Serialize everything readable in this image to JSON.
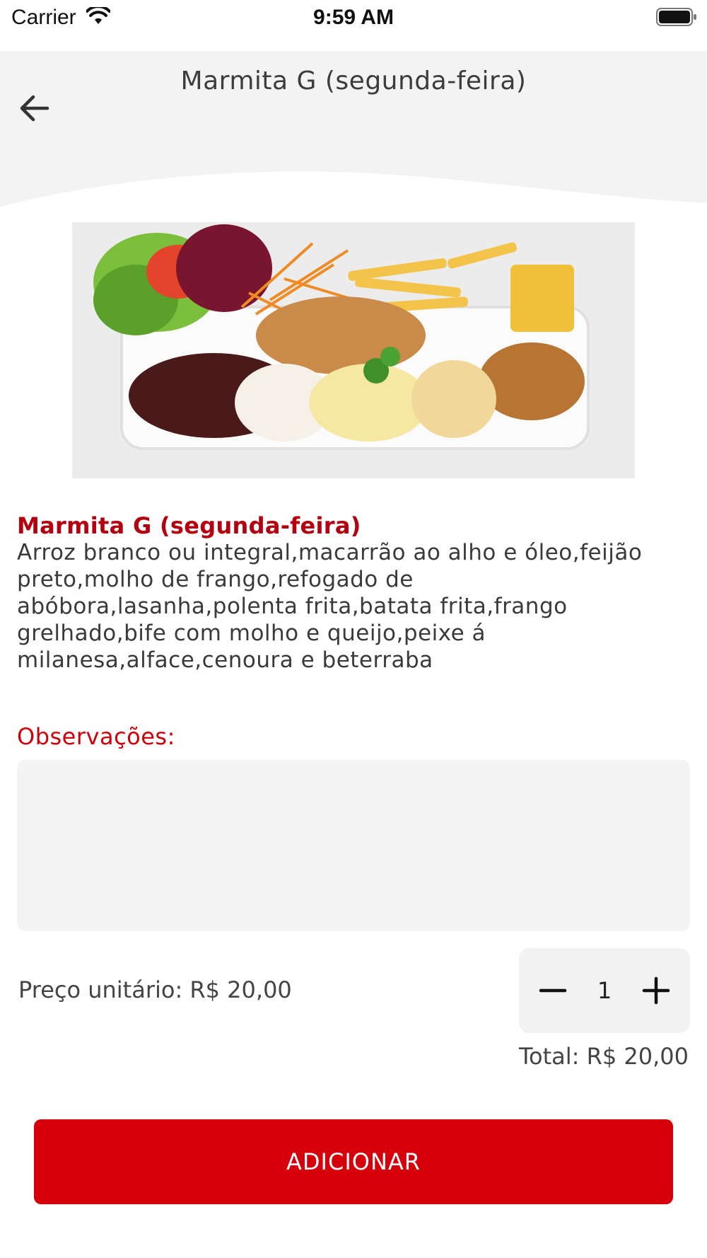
{
  "status_bar": {
    "carrier": "Carrier",
    "time": "9:59 AM",
    "wifi_icon": "wifi-icon",
    "battery_icon": "battery-icon"
  },
  "header": {
    "title": "Marmita G (segunda-feira)",
    "back_icon": "arrow-left-icon"
  },
  "product": {
    "image_alt": "food-tray-image",
    "name": "Marmita G (segunda-feira)",
    "description": "Arroz branco ou integral,macarrão ao alho e óleo,feijão preto,molho de frango,refogado de abóbora,lasanha,polenta frita,batata frita,frango grelhado,bife com molho e queijo,peixe á milanesa,alface,cenoura e beterraba"
  },
  "observations": {
    "label": "Observações:",
    "value": "",
    "placeholder": ""
  },
  "pricing": {
    "unit_price_text": "Preço unitário: R$ 20,00",
    "quantity": "1",
    "total_text": "Total: R$ 20,00",
    "minus_icon": "minus-icon",
    "plus_icon": "plus-icon"
  },
  "actions": {
    "add_label": "ADICIONAR"
  },
  "colors": {
    "accent": "#d6000b",
    "name_red": "#b3010f",
    "header_bg": "#f3f3f3"
  }
}
